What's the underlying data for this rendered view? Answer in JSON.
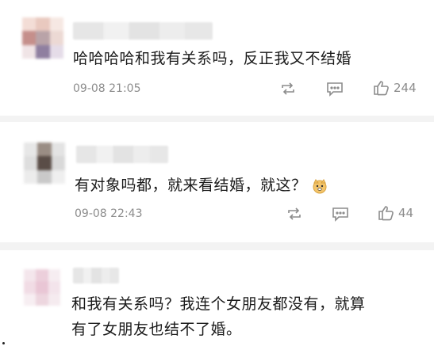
{
  "comments": [
    {
      "text": "哈哈哈哈和我有关系吗，反正我又不结婚",
      "time": "09-08 21:05",
      "likes": "244",
      "icons": [
        "repost-icon",
        "comment-icon",
        "like-icon"
      ]
    },
    {
      "text": "有对象吗都，就来看结婚，就这？",
      "emoji": "doge-emoji",
      "time": "09-08 22:43",
      "likes": "44",
      "icons": [
        "repost-icon",
        "comment-icon",
        "like-icon"
      ]
    },
    {
      "text_line1": "和我有关系吗？我连个女朋友都没有，就算",
      "text_line2": "有了女朋友也结不了婚。"
    }
  ],
  "colors": {
    "text": "#1a1a1a",
    "meta": "#8c8c8c",
    "separator": "#f3f3f3"
  }
}
